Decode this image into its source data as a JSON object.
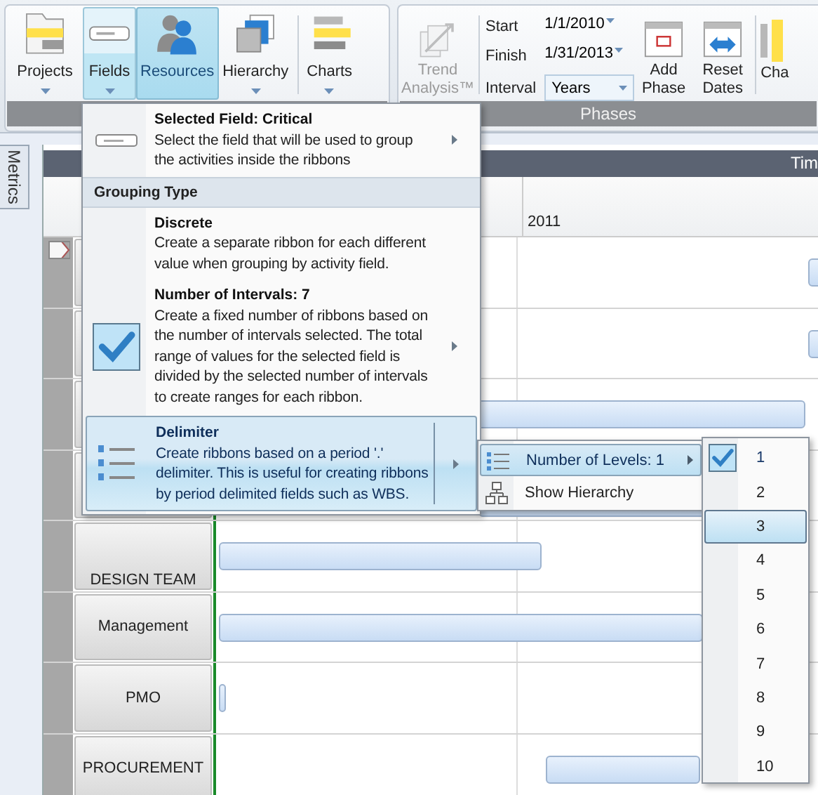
{
  "ribbon": {
    "groups": [
      {
        "buttons": [
          {
            "label": "Projects",
            "dropdown": true,
            "selected": false,
            "hovered": false
          },
          {
            "label": "Fields",
            "dropdown": true,
            "selected": true,
            "hovered": false
          },
          {
            "label": "Resources",
            "dropdown": false,
            "selected": false,
            "hovered": true
          },
          {
            "label": "Hierarchy",
            "dropdown": true,
            "selected": false,
            "hovered": false
          },
          {
            "label": "Charts",
            "dropdown": true,
            "selected": false,
            "hovered": false
          }
        ]
      },
      {
        "title": "Phases",
        "trend": {
          "label": "Trend Analysis™",
          "disabled": true
        },
        "dates": [
          {
            "label": "Start",
            "value": "1/1/2010"
          },
          {
            "label": "Finish",
            "value": "1/31/2013"
          }
        ],
        "interval": {
          "label": "Interval",
          "value": "Years"
        },
        "buttons": [
          {
            "label": "Add Phase"
          },
          {
            "label": "Reset Dates"
          }
        ],
        "cut_button": {
          "label": "Cha"
        }
      }
    ]
  },
  "sidebar": {
    "tabs": [
      {
        "label": "Metrics"
      }
    ]
  },
  "gantt": {
    "header": "Tim",
    "timeline": [
      "2011"
    ],
    "rows": [
      {
        "label": "DESIGN TEAM"
      },
      {
        "label": "Management"
      },
      {
        "label": "PMO"
      },
      {
        "label": "PROCUREMENT"
      }
    ]
  },
  "fields_menu": {
    "items": [
      {
        "kind": "option",
        "title": "Selected Field: Critical",
        "description": "Select the field that will be used to group the activities inside the ribbons",
        "checked": false,
        "highlighted": false,
        "submenu": true
      },
      {
        "kind": "header",
        "title": "Grouping Type"
      },
      {
        "kind": "option",
        "title": "Discrete",
        "description": "Create a separate ribbon for each different value when grouping by activity field.",
        "checked": false,
        "highlighted": false,
        "submenu": false
      },
      {
        "kind": "option",
        "title": "Number of Intervals: 7",
        "description": "Create a fixed number of ribbons based on the number of intervals selected. The total range of values for the selected field is divided by the selected number of intervals to create ranges for each ribbon.",
        "checked": true,
        "highlighted": false,
        "submenu": true
      },
      {
        "kind": "option",
        "title": "Delimiter",
        "description": "Create ribbons based on a period '.' delimiter. This is useful for creating ribbons by period delimited fields such as WBS.",
        "checked": false,
        "highlighted": true,
        "submenu": true
      }
    ]
  },
  "delimiter_menu": {
    "items": [
      {
        "label": "Number of Levels: 1",
        "highlighted": true,
        "submenu": true
      },
      {
        "label": "Show Hierarchy",
        "highlighted": false,
        "submenu": false
      }
    ]
  },
  "levels_menu": {
    "items": [
      {
        "label": "1",
        "checked": true,
        "selected": false
      },
      {
        "label": "2",
        "checked": false,
        "selected": false
      },
      {
        "label": "3",
        "checked": false,
        "selected": true
      },
      {
        "label": "4",
        "checked": false,
        "selected": false
      },
      {
        "label": "5",
        "checked": false,
        "selected": false
      },
      {
        "label": "6",
        "checked": false,
        "selected": false
      },
      {
        "label": "7",
        "checked": false,
        "selected": false
      },
      {
        "label": "8",
        "checked": false,
        "selected": false
      },
      {
        "label": "9",
        "checked": false,
        "selected": false
      },
      {
        "label": "10",
        "checked": false,
        "selected": false
      }
    ]
  }
}
